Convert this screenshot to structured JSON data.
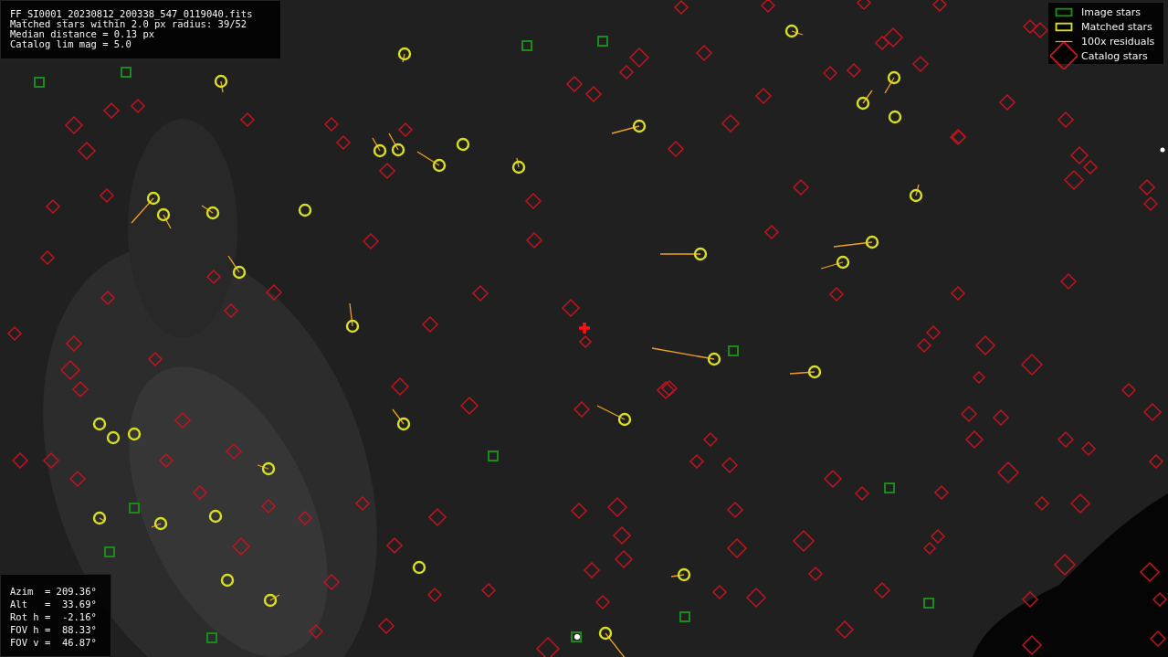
{
  "info": {
    "lines": [
      "FF_SI0001_20230812_200338_547_0119040.fits",
      "Matched stars within 2.0 px radius: 39/52",
      "Median distance = 0.13 px",
      "Catalog lim mag = 5.0"
    ]
  },
  "legend": [
    {
      "label": "Image stars"
    },
    {
      "kind": "matched",
      "label": "Matched stars"
    },
    {
      "kind": "residual",
      "label": "100x residuals"
    },
    {
      "kind": "catalog",
      "label": "Catalog stars"
    }
  ],
  "pointing": {
    "lines": [
      "Azim  = 209.36°",
      "Alt   =  33.69°",
      "Rot h =  -2.16°",
      "FOV h =  88.33°",
      "FOV v =  46.87°"
    ]
  }
}
